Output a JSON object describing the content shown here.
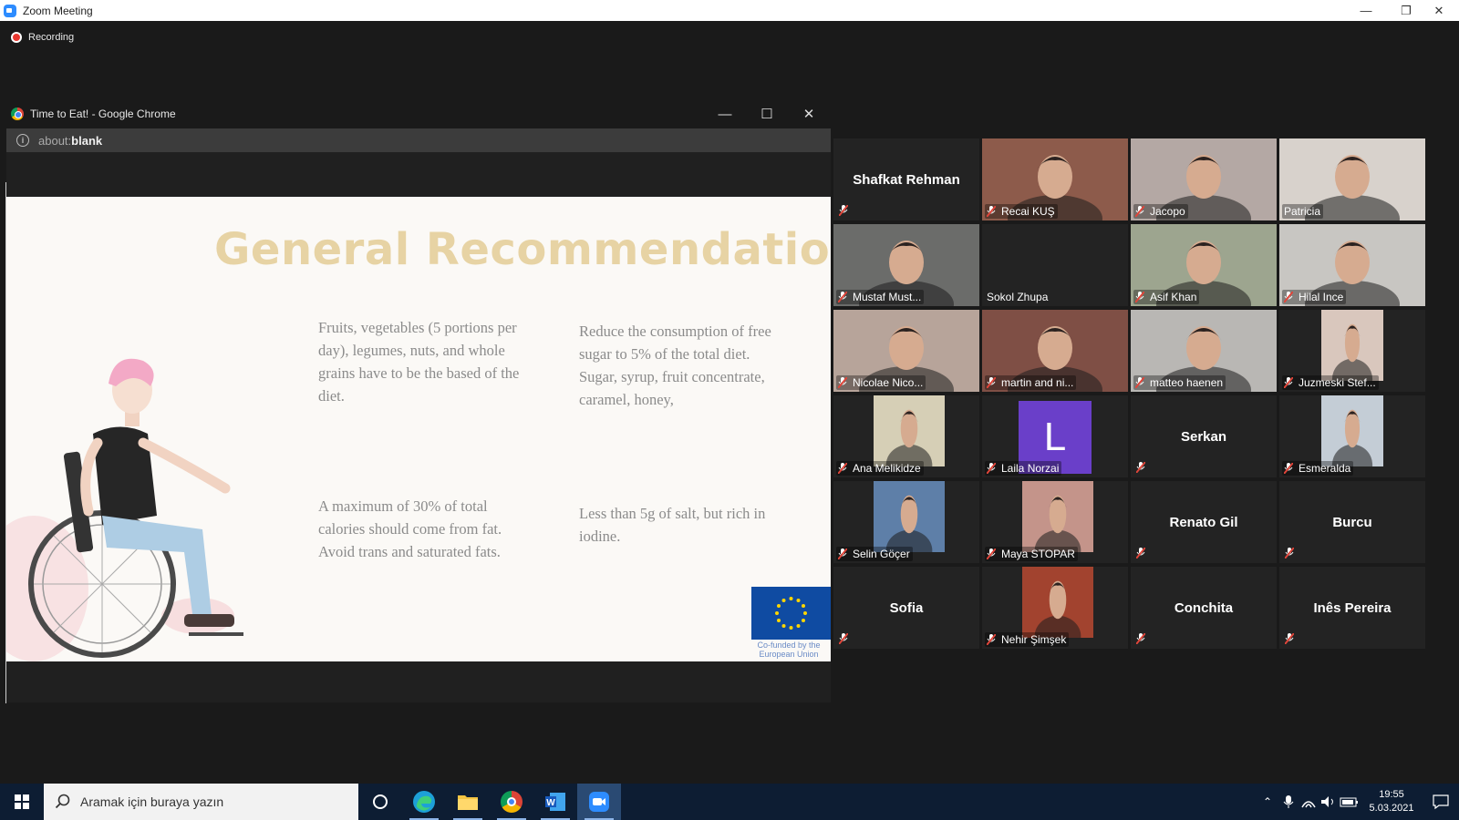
{
  "window": {
    "title": "Zoom Meeting"
  },
  "window_controls": {
    "minimize": "—",
    "restore": "❐",
    "close": "✕"
  },
  "recording": {
    "label": "Recording"
  },
  "chrome": {
    "title": "Time to Eat! - Google Chrome",
    "url_prefix": "about:",
    "url_bold": "blank",
    "controls": {
      "minimize": "—",
      "maximize": "☐",
      "close": "✕"
    }
  },
  "slide": {
    "title": "General Recommendations",
    "items": [
      "Fruits, vegetables (5 portions per day), legumes, nuts, and whole grains have to be the based of the diet.",
      "Reduce the consumption of free sugar to 5% of the total diet.\nSugar, syrup, fruit concentrate, caramel, honey,",
      "A maximum of 30% of total calories should come from fat. Avoid trans and saturated fats.",
      "Less than 5g of salt, but rich in iodine."
    ],
    "eu_caption": "Co-funded by the European Union"
  },
  "participants": [
    {
      "name": "Shafkat Rehman",
      "type": "name-only"
    },
    {
      "name": "Recai KUŞ",
      "type": "video",
      "bg": "#8d5b4b"
    },
    {
      "name": "Jacopo",
      "type": "video",
      "bg": "#b4a8a4"
    },
    {
      "name": "Patricia",
      "type": "video",
      "bg": "#d8d2cc",
      "active": true
    },
    {
      "name": "Mustaf Must...",
      "type": "video",
      "bg": "#6b6c6a"
    },
    {
      "name": "Sokol Zhupa",
      "type": "label-only"
    },
    {
      "name": "Asif Khan",
      "type": "video",
      "bg": "#9da58f"
    },
    {
      "name": "Hilal Ince",
      "type": "video",
      "bg": "#c8c6c2"
    },
    {
      "name": "Nicolae Nico...",
      "type": "video",
      "bg": "#b7a49a"
    },
    {
      "name": "martin and ni...",
      "type": "video",
      "bg": "#7f4f45"
    },
    {
      "name": "matteo haenen",
      "type": "video",
      "bg": "#b9b7b4"
    },
    {
      "name": "Juzmeski Stef...",
      "type": "video-small",
      "bg": "#d9c7bd"
    },
    {
      "name": "Ana Melikidze",
      "type": "video-small",
      "bg": "#d6cfb6"
    },
    {
      "name": "Laila Norzai",
      "type": "avatar",
      "initial": "L"
    },
    {
      "name": "Serkan",
      "type": "name-only"
    },
    {
      "name": "Esmeralda",
      "type": "video-small",
      "bg": "#c4cdd6"
    },
    {
      "name": "Selin Göçer",
      "type": "video-small",
      "bg": "#5e7fa8"
    },
    {
      "name": "Maya STOPAR",
      "type": "video-small",
      "bg": "#c4948a"
    },
    {
      "name": "Renato Gil",
      "type": "name-only"
    },
    {
      "name": "Burcu",
      "type": "name-only"
    },
    {
      "name": "Sofia",
      "type": "name-only"
    },
    {
      "name": "Nehir Şimşek",
      "type": "video-small",
      "bg": "#a2432f"
    },
    {
      "name": "Conchita",
      "type": "name-only"
    },
    {
      "name": "Inês Pereira",
      "type": "name-only"
    }
  ],
  "taskbar": {
    "search_placeholder": "Aramak için buraya yazın",
    "time": "19:55",
    "date": "5.03.2021"
  },
  "colors": {
    "accent": "#2d8cff",
    "active_speaker": "#c9e265",
    "muted": "#e0453a"
  }
}
